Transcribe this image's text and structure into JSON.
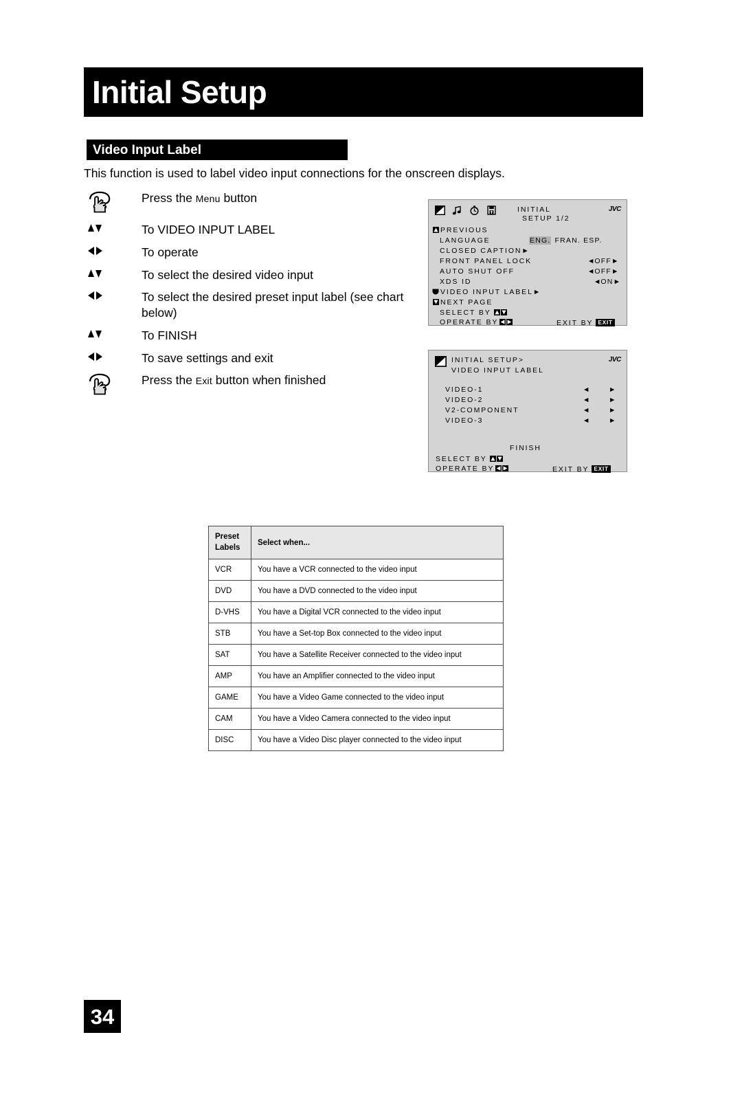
{
  "page": {
    "title": "Initial Setup",
    "section_heading": "Video Input Label",
    "intro": "This function is used to label video input connections for the onscreen displays.",
    "number": "34"
  },
  "steps": [
    {
      "icon": "press-button-icon",
      "text_before": "Press the ",
      "smallcap": "Menu",
      "text_after": " button"
    },
    {
      "icon": "up-down-arrows-icon",
      "text_before": "To VIDEO INPUT LABEL",
      "smallcap": "",
      "text_after": ""
    },
    {
      "icon": "left-right-arrows-icon",
      "text_before": "To operate",
      "smallcap": "",
      "text_after": ""
    },
    {
      "icon": "up-down-arrows-icon",
      "text_before": "To select the desired video input",
      "smallcap": "",
      "text_after": ""
    },
    {
      "icon": "left-right-arrows-icon",
      "text_before": "To select the desired preset input label (see chart below)",
      "smallcap": "",
      "text_after": ""
    },
    {
      "icon": "up-down-arrows-icon",
      "text_before": "To FINISH",
      "smallcap": "",
      "text_after": ""
    },
    {
      "icon": "left-right-arrows-icon",
      "text_before": "To save settings and exit",
      "smallcap": "",
      "text_after": ""
    },
    {
      "icon": "press-button-icon",
      "text_before": "Press the ",
      "smallcap": "Exit",
      "text_after": " button when finished"
    }
  ],
  "osd_top": {
    "brand": "JVC",
    "header_line1": "INITIAL",
    "header_line2": "SETUP 1/2",
    "previous": "PREVIOUS",
    "language_label": "LANGUAGE",
    "language_selected": "ENG.",
    "language_options": "FRAN. ESP.",
    "closed_caption": "CLOSED CAPTION",
    "front_panel_lock_label": "FRONT PANEL LOCK",
    "front_panel_lock_value": "OFF",
    "auto_shut_off_label": "AUTO SHUT OFF",
    "auto_shut_off_value": "OFF",
    "xds_id_label": "XDS ID",
    "xds_id_value": "ON",
    "video_input_label": "VIDEO INPUT LABEL",
    "next_page": "NEXT PAGE",
    "select_by": "SELECT    BY",
    "operate_by": "OPERATE BY",
    "exit_by": "EXIT BY",
    "exit_badge": "EXIT"
  },
  "osd_bottom": {
    "brand": "JVC",
    "header_line1": "INITIAL SETUP>",
    "header_line2": "VIDEO INPUT LABEL",
    "rows": [
      "VIDEO-1",
      "VIDEO-2",
      "V2-COMPONENT",
      "VIDEO-3"
    ],
    "finish": "FINISH",
    "select_by": "SELECT    BY",
    "operate_by": "OPERATE BY",
    "exit_by": "EXIT BY",
    "exit_badge": "EXIT"
  },
  "table": {
    "headers": [
      "Preset\nLabels",
      "Select when..."
    ],
    "header_label_line1": "Preset",
    "header_label_line2": "Labels",
    "header_desc": "Select when...",
    "rows": [
      {
        "label": "VCR",
        "desc": "You have a VCR connected to the video input"
      },
      {
        "label": "DVD",
        "desc": "You have a DVD connected to the video input"
      },
      {
        "label": "D-VHS",
        "desc": "You have a Digital VCR connected to the video input"
      },
      {
        "label": "STB",
        "desc": "You have a Set-top Box connected to the video input"
      },
      {
        "label": "SAT",
        "desc": "You have a Satellite Receiver connected to the video input"
      },
      {
        "label": "AMP",
        "desc": "You have an Amplifier connected to the video input"
      },
      {
        "label": "GAME",
        "desc": "You have a Video Game connected to the video input"
      },
      {
        "label": "CAM",
        "desc": "You have a Video Camera connected to the video input"
      },
      {
        "label": "DISC",
        "desc": "You have a Video Disc player connected to the video input"
      }
    ]
  },
  "colors": {
    "banner_bg": "#000000",
    "banner_fg": "#ffffff",
    "osd_bg": "#d4d4d4",
    "osd_highlight": "#b0b0b0",
    "table_header_bg": "#e6e6e6"
  }
}
